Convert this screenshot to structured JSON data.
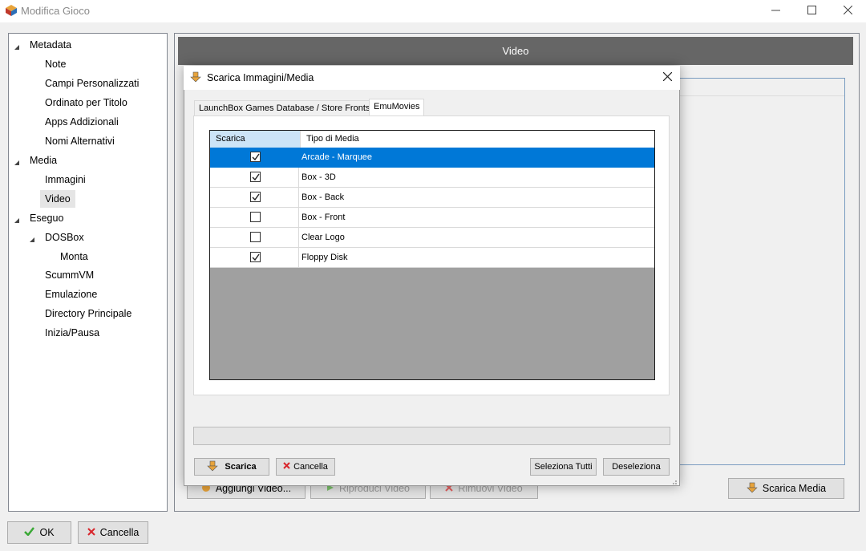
{
  "window": {
    "title": "Modifica Gioco"
  },
  "tree": {
    "items": [
      {
        "label": "Metadata",
        "expanded": true
      },
      {
        "label": "Note"
      },
      {
        "label": "Campi Personalizzati"
      },
      {
        "label": "Ordinato per Titolo"
      },
      {
        "label": "Apps Addizionali"
      },
      {
        "label": "Nomi Alternativi"
      },
      {
        "label": "Media",
        "expanded": true
      },
      {
        "label": "Immagini"
      },
      {
        "label": "Video",
        "selected": true
      },
      {
        "label": "Eseguo",
        "expanded": true
      },
      {
        "label": "DOSBox",
        "expanded": true
      },
      {
        "label": "Monta"
      },
      {
        "label": "ScummVM"
      },
      {
        "label": "Emulazione"
      },
      {
        "label": "Directory Principale"
      },
      {
        "label": "Inizia/Pausa"
      }
    ]
  },
  "panel": {
    "header": "Video",
    "add_video": "Aggiungi Video...",
    "play_video": "Riproduci Video",
    "remove_video": "Rimuovi Video",
    "download_media": "Scarica Media"
  },
  "footer": {
    "ok": "OK",
    "cancel": "Cancella"
  },
  "dialog": {
    "title": "Scarica Immagini/Media",
    "tabs": [
      "LaunchBox Games Database / Store Fronts",
      "EmuMovies"
    ],
    "active_tab": "EmuMovies",
    "grid": {
      "columns": [
        "Scarica",
        "Tipo di Media"
      ],
      "rows": [
        {
          "checked": true,
          "name": "Arcade - Marquee",
          "selected": true
        },
        {
          "checked": true,
          "name": "Box - 3D"
        },
        {
          "checked": true,
          "name": "Box - Back"
        },
        {
          "checked": false,
          "name": "Box - Front"
        },
        {
          "checked": false,
          "name": "Clear Logo"
        },
        {
          "checked": true,
          "name": "Floppy Disk"
        }
      ]
    },
    "buttons": {
      "download": "Scarica",
      "cancel": "Cancella",
      "select_all": "Seleziona Tutti",
      "deselect": "Deseleziona"
    }
  },
  "colors": {
    "selection": "#0078d7",
    "header_bar": "#666666",
    "ok_green": "#3aa835",
    "cancel_red": "#d8262c"
  }
}
